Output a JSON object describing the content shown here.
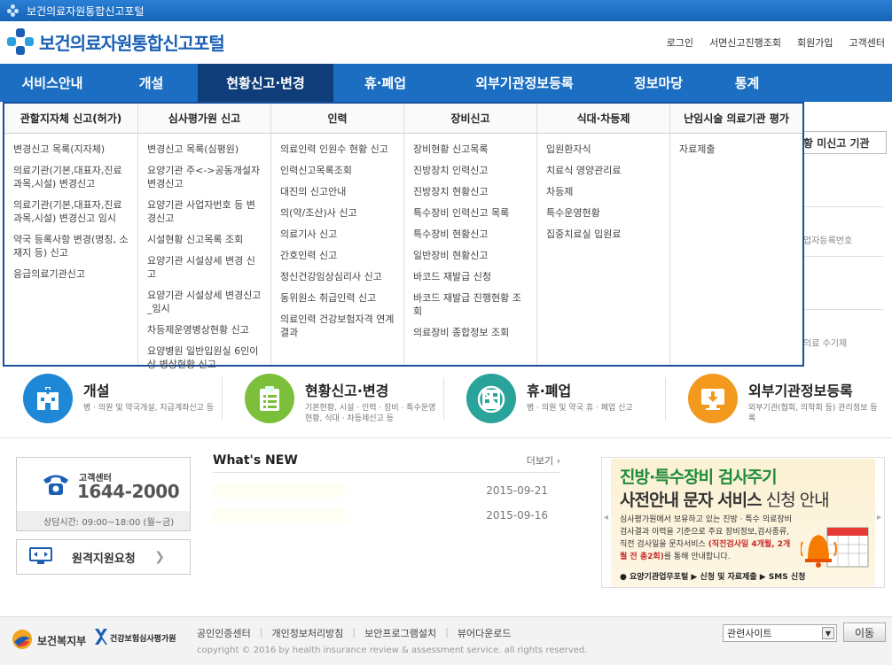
{
  "window": {
    "title": "보건의료자원통합신고포털"
  },
  "header": {
    "logo_text": "보건의료자원통합신고포털",
    "util_links": [
      "로그인",
      "서면신고진행조회",
      "회원가입",
      "고객센터"
    ]
  },
  "gnb": {
    "items": [
      "서비스안내",
      "개설",
      "현황신고·변경",
      "휴·폐업",
      "외부기관정보등록",
      "정보마당",
      "통계"
    ],
    "active_index": 2
  },
  "megamenu": {
    "columns": [
      {
        "heading": "관할지자체 신고(허가)",
        "items": [
          "변경신고 목록(지자체)",
          "의료기관(기본,대표자,진료과목,시설) 변경신고",
          "의료기관(기본,대표자,진료과목,시설) 변경신고 임시",
          "약국 등록사항 변경(명칭, 소재지 등) 신고",
          "응급의료기관신고"
        ]
      },
      {
        "heading": "심사평가원 신고",
        "items": [
          "변경신고 목록(심평원)",
          "요양기관 주<->공동개설자 변경신고",
          "요양기관 사업자번호 등 변경신고",
          "시설현황 신고목록 조회",
          "요양기관 시설상세 변경 신고",
          "요양기관 시설상세 변경신고_임시",
          "차등제운영병상현황 신고",
          "요양병원 일반입원실 6인이상 병상현황 신고"
        ]
      },
      {
        "heading": "인력",
        "items": [
          "의료인력 인원수 현황 신고",
          "인력신고목록조회",
          "대진의 신고안내",
          "의(약/조산)사 신고",
          "의료기사 신고",
          "간호인력 신고",
          "정신건강임상심리사 신고",
          "동위원소 취급인력 신고",
          "의료인력 건강보험자격 연계결과"
        ]
      },
      {
        "heading": "장비신고",
        "items": [
          "장비현황 신고목록",
          "진방장치 인력신고",
          "진방장치 현황신고",
          "특수장비 인력신고 목록",
          "특수장비 현황신고",
          "일반장비 현황신고",
          "바코드 재발급 신청",
          "바코드 재발급 진행현황 조회",
          "의료장비 종합정보 조회"
        ]
      },
      {
        "heading": "식대·차등제",
        "items": [
          "입원환자식",
          "치료식 영양관리료",
          "차등제",
          "특수운영현황",
          "집중치료실 입원료"
        ]
      },
      {
        "heading": "난임시술 의료기관 평가",
        "items": [
          "자료제출"
        ]
      }
    ]
  },
  "background_peek": {
    "tab_label": "황 미신고 기관",
    "texts": [
      "업자등록번호",
      "의료 수기제"
    ]
  },
  "quick_links": [
    {
      "title": "개설",
      "sub": "병 · 의원 및 약국개설, 지급계좌신고 등",
      "icon": "hospital-icon",
      "color": "#1e88d6"
    },
    {
      "title": "현황신고·변경",
      "sub": "기본현황, 시설 · 인력 · 장비 · 특수운영현황, 식대 · 차등제신고 등",
      "icon": "clipboard-icon",
      "color": "#7cbf3a"
    },
    {
      "title": "휴·폐업",
      "sub": "병 · 의원 및 약국 휴 · 폐업 신고",
      "icon": "no-entry-icon",
      "color": "#2aa39a"
    },
    {
      "title": "외부기관정보등록",
      "sub": "외부기관(협회, 의학회 등) 관리정보 등록",
      "icon": "download-monitor-icon",
      "color": "#f39a1e"
    }
  ],
  "customer_center": {
    "label": "고객센터",
    "number": "1644-2000",
    "hours": "상담시간: 09:00~18:00 (월~금)"
  },
  "remote": {
    "label": "원격지원요청"
  },
  "news": {
    "title": "What's NEW",
    "more": "더보기",
    "items": [
      {
        "date": "2015-09-21"
      },
      {
        "date": "2015-09-16"
      }
    ]
  },
  "banner": {
    "line1": "진방·특수장비 검사주기",
    "line2_bold": "사전안내 문자 서비스",
    "line2_light": " 신청 안내",
    "body1": "심사평가원에서 보유하고 있는 진방 · 특수 의료장비 검사결과 이력을 기준으로 주요 장비정보,검사종류, 직전 검사일을 문자서비스",
    "body_red": "(직전검사일 4개월, 2개월 전 총2회)",
    "body2": "를 통해 안내합니다.",
    "foot": "● 요양기관업무포털 ▶ 신청 및 자료제출 ▶ SMS 신청"
  },
  "footer": {
    "org1": "보건복지부",
    "org2": "건강보험심사평가원",
    "links": [
      "공인인증센터",
      "개인정보처리방침",
      "보안프로그램설치",
      "뷰어다운로드"
    ],
    "copyright": "copyright © 2016 by health insurance review & assessment service. all rights reserved.",
    "select_value": "관련사이트",
    "go_button": "이동"
  },
  "colors": {
    "primary": "#1b6ec2",
    "active_nav": "#0f3d7a",
    "megamenu_border": "#1b4f9c",
    "green": "#1f8c3a"
  }
}
